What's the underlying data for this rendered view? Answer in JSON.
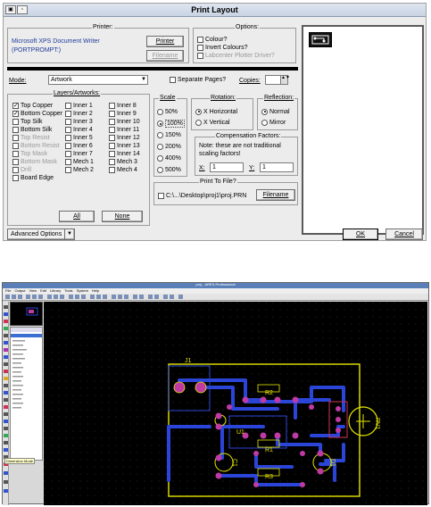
{
  "dialog": {
    "title": "Print Layout",
    "printer": {
      "caption": "Printer:",
      "name": "Microsoft XPS Document Writer",
      "port": "(PORTPROMPT:)",
      "printer_btn": "Printer",
      "filename_btn": "Filename"
    },
    "options": {
      "caption": "Options:",
      "items": [
        {
          "label": "Colour?",
          "checked": false,
          "enabled": true
        },
        {
          "label": "Invert Colours?",
          "checked": false,
          "enabled": true
        },
        {
          "label": "Labcenter Plotter Driver?",
          "checked": false,
          "enabled": false
        }
      ]
    },
    "mode": {
      "label": "Mode:",
      "value": "Artwork",
      "separate_pages": "Separate Pages?",
      "copies_label": "Copies:",
      "copies_value": ""
    },
    "layers": {
      "caption": "Layers/Artworks:",
      "col1": [
        {
          "label": "Top Copper",
          "checked": true,
          "enabled": true
        },
        {
          "label": "Bottom Copper",
          "checked": true,
          "enabled": true
        },
        {
          "label": "Top Silk",
          "checked": false,
          "enabled": true
        },
        {
          "label": "Bottom Silk",
          "checked": false,
          "enabled": true
        },
        {
          "label": "Top Resist",
          "checked": false,
          "enabled": false
        },
        {
          "label": "Bottom Resist",
          "checked": false,
          "enabled": false
        },
        {
          "label": "Top Mask",
          "checked": false,
          "enabled": false
        },
        {
          "label": "Bottom Mask",
          "checked": false,
          "enabled": false
        },
        {
          "label": "Drill",
          "checked": false,
          "enabled": false
        },
        {
          "label": "Board Edge",
          "checked": false,
          "enabled": true
        }
      ],
      "col2": [
        {
          "label": "Inner 1"
        },
        {
          "label": "Inner 2"
        },
        {
          "label": "Inner 3"
        },
        {
          "label": "Inner 4"
        },
        {
          "label": "Inner 5"
        },
        {
          "label": "Inner 6"
        },
        {
          "label": "Inner 7"
        },
        {
          "label": "Mech 1"
        },
        {
          "label": "Mech 2"
        }
      ],
      "col3": [
        {
          "label": "Inner 8"
        },
        {
          "label": "Inner 9"
        },
        {
          "label": "Inner 10"
        },
        {
          "label": "Inner 11"
        },
        {
          "label": "Inner 12"
        },
        {
          "label": "Inner 13"
        },
        {
          "label": "Inner 14"
        },
        {
          "label": "Mech 3"
        },
        {
          "label": "Mech 4"
        }
      ],
      "all_btn": "All",
      "none_btn": "None"
    },
    "scale": {
      "caption": "Scale",
      "items": [
        "50%",
        "100%",
        "150%",
        "200%",
        "400%",
        "500%"
      ],
      "selected": "100%"
    },
    "rotation": {
      "caption": "Rotation:",
      "items": [
        "X Horizontal",
        "X Vertical"
      ],
      "selected": "X Horizontal"
    },
    "reflection": {
      "caption": "Reflection:",
      "items": [
        "Normal",
        "Mirror"
      ],
      "selected": "Normal"
    },
    "compensation": {
      "caption": "Compensation Factors:",
      "note": "Note: these are not traditional scaling factors!",
      "x_label": "X:",
      "x_value": "1",
      "y_label": "Y:",
      "y_value": "1"
    },
    "print_to_file": {
      "caption": "Print To File?",
      "path": "C:\\...\\Desktop\\proj1\\proj.PRN",
      "filename_btn": "Filename"
    },
    "advanced_btn": "Advanced Options",
    "ok_btn": "OK",
    "cancel_btn": "Cancel"
  },
  "app": {
    "title": "proj - ARES Professional",
    "menu": [
      "File",
      "Output",
      "View",
      "Edit",
      "Library",
      "Tools",
      "System",
      "Help"
    ],
    "status": "Dimension Mode",
    "components": {
      "j1": "J1",
      "r2": "R2",
      "r1": "R1",
      "r3": "R3",
      "rv1": "RV1",
      "u1": "U1",
      "c1": "C1",
      "d1": "D1"
    }
  },
  "colors": {
    "dialog_bg": "#ececec",
    "board_bg": "#000000",
    "trace": "#2b45d8",
    "outline": "#e6e600",
    "pad": "#c03aa6"
  }
}
